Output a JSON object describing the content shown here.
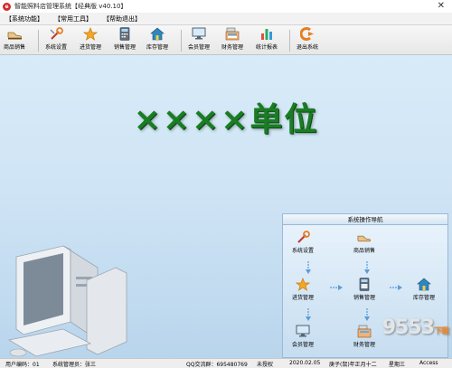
{
  "window": {
    "title": "智能照料店管理系统【经典版 v40.10】",
    "close_label": "✕"
  },
  "menu": {
    "items": [
      {
        "label": "【系统功能】"
      },
      {
        "label": "【常用工具】"
      },
      {
        "label": "【帮助退出】"
      }
    ]
  },
  "toolbar": {
    "items": [
      {
        "label": "商品销售",
        "icon": "shoe-icon"
      },
      {
        "label": "系统设置",
        "icon": "settings-icon"
      },
      {
        "label": "进货管理",
        "icon": "star-icon"
      },
      {
        "label": "销售管理",
        "icon": "calculator-icon"
      },
      {
        "label": "库存管理",
        "icon": "house-icon"
      },
      {
        "label": "会员管理",
        "icon": "monitor-icon"
      },
      {
        "label": "财务管理",
        "icon": "cash-register-icon"
      },
      {
        "label": "统计报表",
        "icon": "bar-chart-icon"
      },
      {
        "label": "退出系统",
        "icon": "exit-icon"
      }
    ]
  },
  "main": {
    "unit_title": "××××单位"
  },
  "nav_panel": {
    "title": "系统操作导航",
    "nodes": [
      {
        "label": "系统设置",
        "icon": "settings-icon"
      },
      {
        "label": "商品销售",
        "icon": "shoe-icon"
      },
      {
        "label": "进货管理",
        "icon": "star-icon"
      },
      {
        "label": "销售管理",
        "icon": "calculator-icon"
      },
      {
        "label": "库存管理",
        "icon": "house-icon"
      },
      {
        "label": "会员管理",
        "icon": "monitor-icon"
      },
      {
        "label": "财务管理",
        "icon": "cash-register-icon"
      }
    ]
  },
  "statusbar": {
    "user_code": "用户编码：01",
    "admin": "系统管理员：张三",
    "qq": "QQ交流群：695480769",
    "license": "未授权",
    "date": "2020.02.05",
    "lunar": "庚子(鼠)年正月十二",
    "weekday": "星期三",
    "db": "Access"
  },
  "watermark": {
    "text": "9553",
    "sub": "下载"
  },
  "colors": {
    "title_green": "#1a7d24",
    "background_blue": "#cfe4f5",
    "logo_red": "#d42a2a"
  }
}
